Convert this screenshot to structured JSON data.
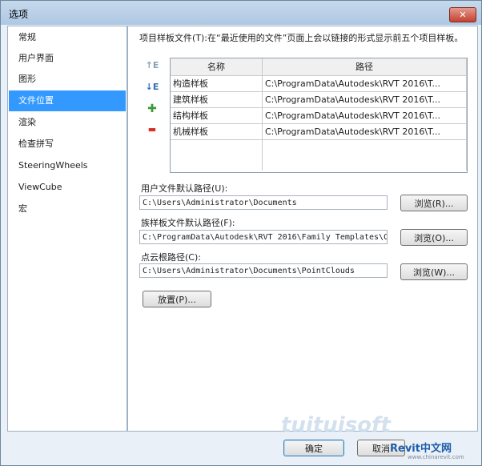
{
  "window": {
    "title": "选项",
    "close": "✕"
  },
  "sidebar": {
    "items": [
      {
        "label": "常规"
      },
      {
        "label": "用户界面"
      },
      {
        "label": "图形"
      },
      {
        "label": "文件位置"
      },
      {
        "label": "渲染"
      },
      {
        "label": "检查拼写"
      },
      {
        "label": "SteeringWheels"
      },
      {
        "label": "ViewCube"
      },
      {
        "label": "宏"
      }
    ],
    "selected": "文件位置"
  },
  "main": {
    "description": "项目样板文件(T):在“最近使用的文件”页面上会以链接的形式显示前五个项目样板。",
    "toolbar": {
      "move_up": "↑E",
      "move_down": "↓E",
      "add": "✚",
      "remove": "▬"
    },
    "table": {
      "headers": [
        "名称",
        "路径"
      ],
      "rows": [
        {
          "name": "构造样板",
          "path": "C:\\ProgramData\\Autodesk\\RVT 2016\\T..."
        },
        {
          "name": "建筑样板",
          "path": "C:\\ProgramData\\Autodesk\\RVT 2016\\T..."
        },
        {
          "name": "结构样板",
          "path": "C:\\ProgramData\\Autodesk\\RVT 2016\\T..."
        },
        {
          "name": "机械样板",
          "path": "C:\\ProgramData\\Autodesk\\RVT 2016\\T..."
        }
      ]
    },
    "user_path": {
      "label": "用户文件默认路径(U):",
      "value": "C:\\Users\\Administrator\\Documents",
      "browse": "浏览(R)..."
    },
    "family_path": {
      "label": "族样板文件默认路径(F):",
      "value": "C:\\ProgramData\\Autodesk\\RVT 2016\\Family Templates\\C",
      "browse": "浏览(O)..."
    },
    "cloud_path": {
      "label": "点云根路径(C):",
      "value": "C:\\Users\\Administrator\\Documents\\PointClouds",
      "browse": "浏览(W)..."
    },
    "places_button": "放置(P)..."
  },
  "footer": {
    "ok": "确定",
    "cancel": "取消"
  },
  "watermark": {
    "text": "tuituisoft",
    "brand": "Revit中文网",
    "brand_url": "www.chinarevit.com"
  },
  "colors": {
    "selection": "#3399ff",
    "add_icon": "#3a9a3a",
    "remove_icon": "#d9302a",
    "arrow_icon": "#2f6fb3"
  }
}
